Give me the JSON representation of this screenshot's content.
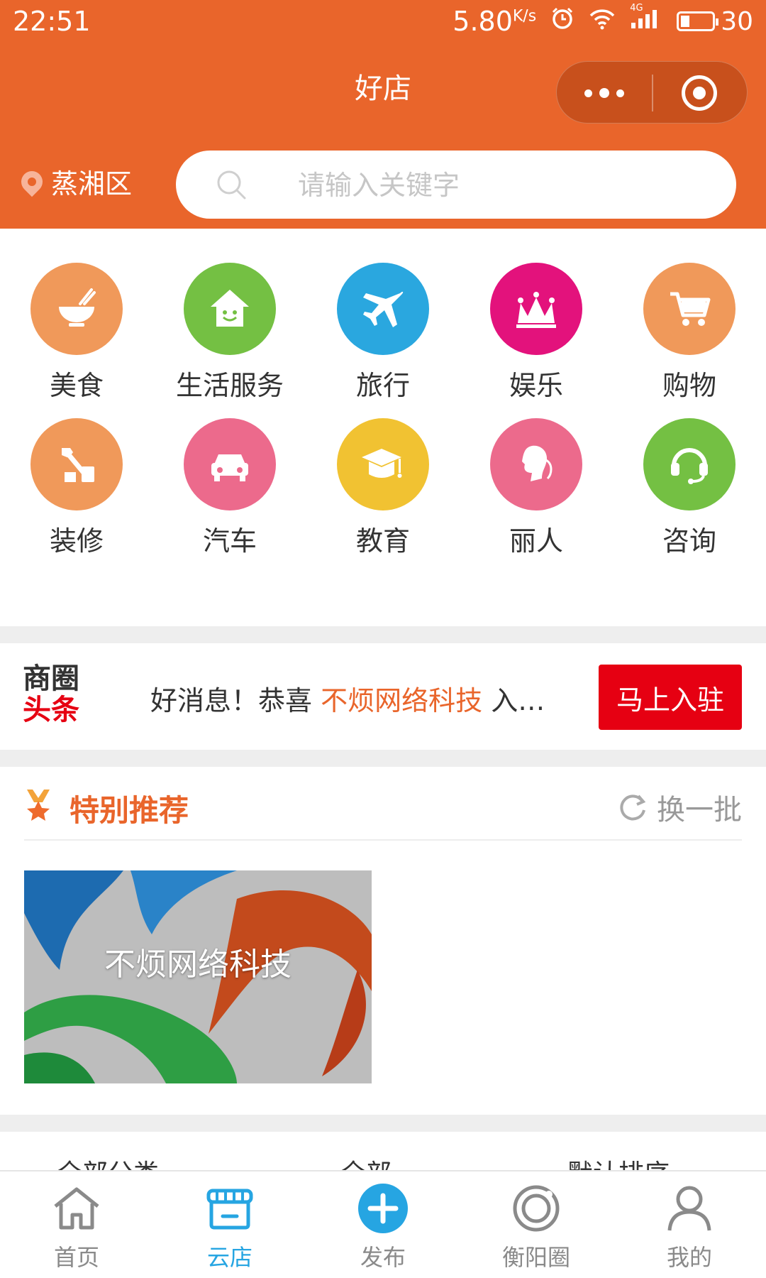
{
  "status_bar": {
    "time": "22:51",
    "net_speed": "5.80",
    "net_unit": "K/s",
    "network": "4G",
    "battery": "30"
  },
  "nav": {
    "title": "好店"
  },
  "location": {
    "label": "蒸湘区"
  },
  "search": {
    "placeholder": "请输入关键字"
  },
  "categories": [
    {
      "label": "美食",
      "icon": "bowl-icon",
      "color": "#f0995a"
    },
    {
      "label": "生活服务",
      "icon": "house-icon",
      "color": "#74c043"
    },
    {
      "label": "旅行",
      "icon": "airplane-icon",
      "color": "#2aa7df"
    },
    {
      "label": "娱乐",
      "icon": "crown-icon",
      "color": "#e3127c"
    },
    {
      "label": "购物",
      "icon": "cart-icon",
      "color": "#f0995a"
    },
    {
      "label": "装修",
      "icon": "tools-icon",
      "color": "#f0995a"
    },
    {
      "label": "汽车",
      "icon": "car-icon",
      "color": "#ec6a8c"
    },
    {
      "label": "教育",
      "icon": "graduation-cap-icon",
      "color": "#f1c232"
    },
    {
      "label": "丽人",
      "icon": "woman-head-icon",
      "color": "#ec6a8c"
    },
    {
      "label": "咨询",
      "icon": "headset-icon",
      "color": "#74c043"
    }
  ],
  "headline": {
    "logo_line1": "商圈",
    "logo_line2": "头条",
    "prefix": "好消息！恭喜 ",
    "highlight": "不烦网络科技",
    "suffix": " 入…",
    "button": "马上入驻",
    "highlight_color": "#e9652b",
    "button_color": "#e60012"
  },
  "recommend": {
    "title": "特别推荐",
    "refresh": "换一批",
    "store_name": "不烦网络科技"
  },
  "filters": [
    "全部分类",
    "全部",
    "默认排序"
  ],
  "tabs": [
    {
      "label": "首页",
      "icon": "home-icon"
    },
    {
      "label": "云店",
      "icon": "store-icon"
    },
    {
      "label": "发布",
      "icon": "plus-circle-icon"
    },
    {
      "label": "衡阳圈",
      "icon": "ring-icon"
    },
    {
      "label": "我的",
      "icon": "person-icon"
    }
  ],
  "colors": {
    "brand": "#e9652b",
    "active_tab": "#26a5e2"
  }
}
